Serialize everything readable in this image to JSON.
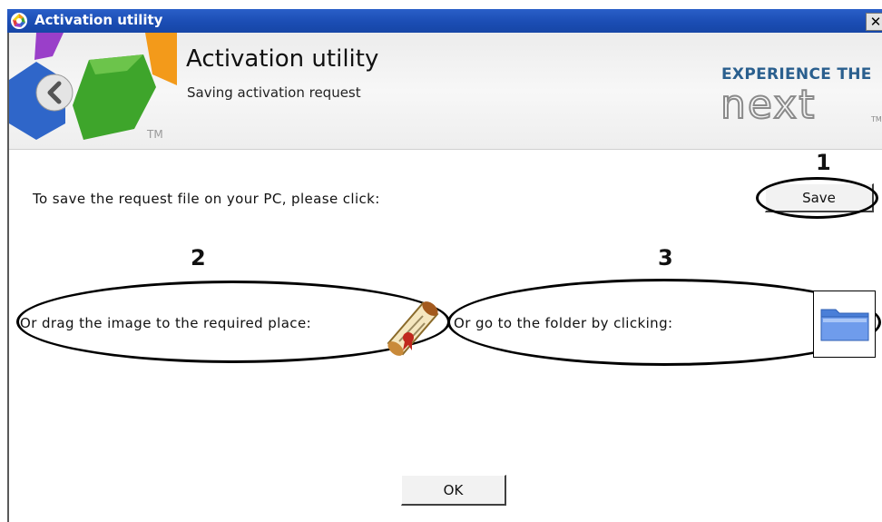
{
  "window": {
    "title": "Activation utility",
    "close_glyph": "✕"
  },
  "header": {
    "title": "Activation utility",
    "subtitle": "Saving activation request",
    "trademark": "TM",
    "brand_line1": "EXPERIENCE THE",
    "brand_line2": "next",
    "brand_color": "#2a5f8e",
    "back_icon": "back-arrow-icon"
  },
  "content": {
    "save_prompt": "To save the request file on your PC, please click:",
    "save_button": "Save",
    "drag_prompt": "Or drag the image to the required place:",
    "folder_prompt": "Or go to the folder by clicking:",
    "ok_button": "OK",
    "step_labels": [
      "1",
      "2",
      "3"
    ],
    "icons": {
      "drag": "scroll-document-icon",
      "folder": "folder-icon"
    }
  },
  "colors": {
    "titlebar": "#1b4db4",
    "annotation": "#000000",
    "logo_blue": "#2f66c9",
    "logo_green": "#3ea52b",
    "logo_orange": "#f39a1a",
    "logo_purple": "#9a3fc9",
    "folder": "#5b8ee6"
  }
}
